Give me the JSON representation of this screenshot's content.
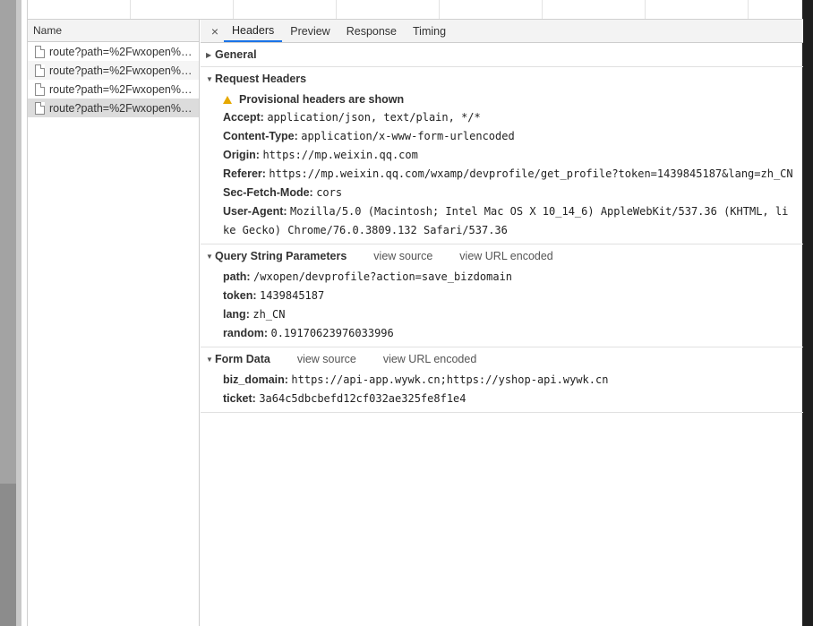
{
  "name_column": {
    "header": "Name",
    "requests": [
      "route?path=%2Fwxopen%…",
      "route?path=%2Fwxopen%…",
      "route?path=%2Fwxopen%…",
      "route?path=%2Fwxopen%…"
    ],
    "selected_index": 3
  },
  "tabs": {
    "close": "×",
    "items": [
      "Headers",
      "Preview",
      "Response",
      "Timing"
    ],
    "active": "Headers"
  },
  "general": {
    "title": "General"
  },
  "request_headers": {
    "title": "Request Headers",
    "warning": "Provisional headers are shown",
    "items": [
      {
        "k": "Accept:",
        "v": "application/json, text/plain, */*"
      },
      {
        "k": "Content-Type:",
        "v": "application/x-www-form-urlencoded"
      },
      {
        "k": "Origin:",
        "v": "https://mp.weixin.qq.com"
      },
      {
        "k": "Referer:",
        "v": "https://mp.weixin.qq.com/wxamp/devprofile/get_profile?token=1439845187&lang=zh_CN"
      },
      {
        "k": "Sec-Fetch-Mode:",
        "v": "cors"
      },
      {
        "k": "User-Agent:",
        "v": "Mozilla/5.0 (Macintosh; Intel Mac OS X 10_14_6) AppleWebKit/537.36 (KHTML, like Gecko) Chrome/76.0.3809.132 Safari/537.36"
      }
    ]
  },
  "query_string": {
    "title": "Query String Parameters",
    "view_source": "view source",
    "view_url_encoded": "view URL encoded",
    "items": [
      {
        "k": "path:",
        "v": "/wxopen/devprofile?action=save_bizdomain"
      },
      {
        "k": "token:",
        "v": "1439845187"
      },
      {
        "k": "lang:",
        "v": "zh_CN"
      },
      {
        "k": "random:",
        "v": "0.19170623976033996"
      }
    ]
  },
  "form_data": {
    "title": "Form Data",
    "view_source": "view source",
    "view_url_encoded": "view URL encoded",
    "items": [
      {
        "k": "biz_domain:",
        "v": "https://api-app.wywk.cn;https://yshop-api.wywk.cn"
      },
      {
        "k": "ticket:",
        "v": "3a64c5dbcbefd12cf032ae325fe8f1e4"
      }
    ]
  },
  "icons": {
    "triangle_open": "▼",
    "triangle_closed": "▶",
    "file": "file-icon",
    "warning": "warning-icon"
  },
  "colors": {
    "active_tab_underline": "#1a73e8",
    "warning": "#e6a800",
    "selected_row": "#dcdcdc"
  }
}
